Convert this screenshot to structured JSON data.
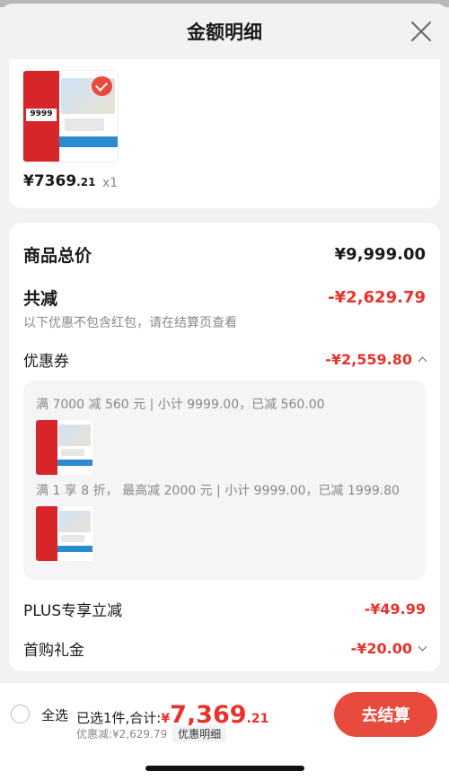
{
  "modal": {
    "title": "金额明细"
  },
  "product": {
    "price_main": "¥7369",
    "price_dec": ".21",
    "quantity": "x1",
    "thumb_price": "9999"
  },
  "summary": {
    "total_label": "商品总价",
    "total_value": "¥9,999.00",
    "reduce_label": "共减",
    "reduce_value": "-¥2,629.79",
    "note": "以下优惠不包含红包，请在结算页查看",
    "coupon_label": "优惠券",
    "coupon_value": "-¥2,559.80",
    "coupons": [
      {
        "text": "满 7000 减 560 元 | 小计 9999.00，已减 560.00"
      },
      {
        "text": "满 1 享 8 折， 最高减 2000 元 | 小计 9999.00，已减 1999.80"
      }
    ],
    "plus_label": "PLUS专享立减",
    "plus_value": "-¥49.99",
    "first_label": "首购礼金",
    "first_value": "-¥20.00"
  },
  "footer": {
    "select_all": "全选",
    "selected_prefix": "已选1件,合计:",
    "total_symbol": "¥",
    "total_int": "7,369",
    "total_dec": ".21",
    "discount_text": "优惠减:¥2,629.79",
    "discount_detail": "优惠明细",
    "checkout_label": "去结算"
  },
  "colors": {
    "accent": "#e8332a",
    "checkout": "#e84a3d"
  }
}
